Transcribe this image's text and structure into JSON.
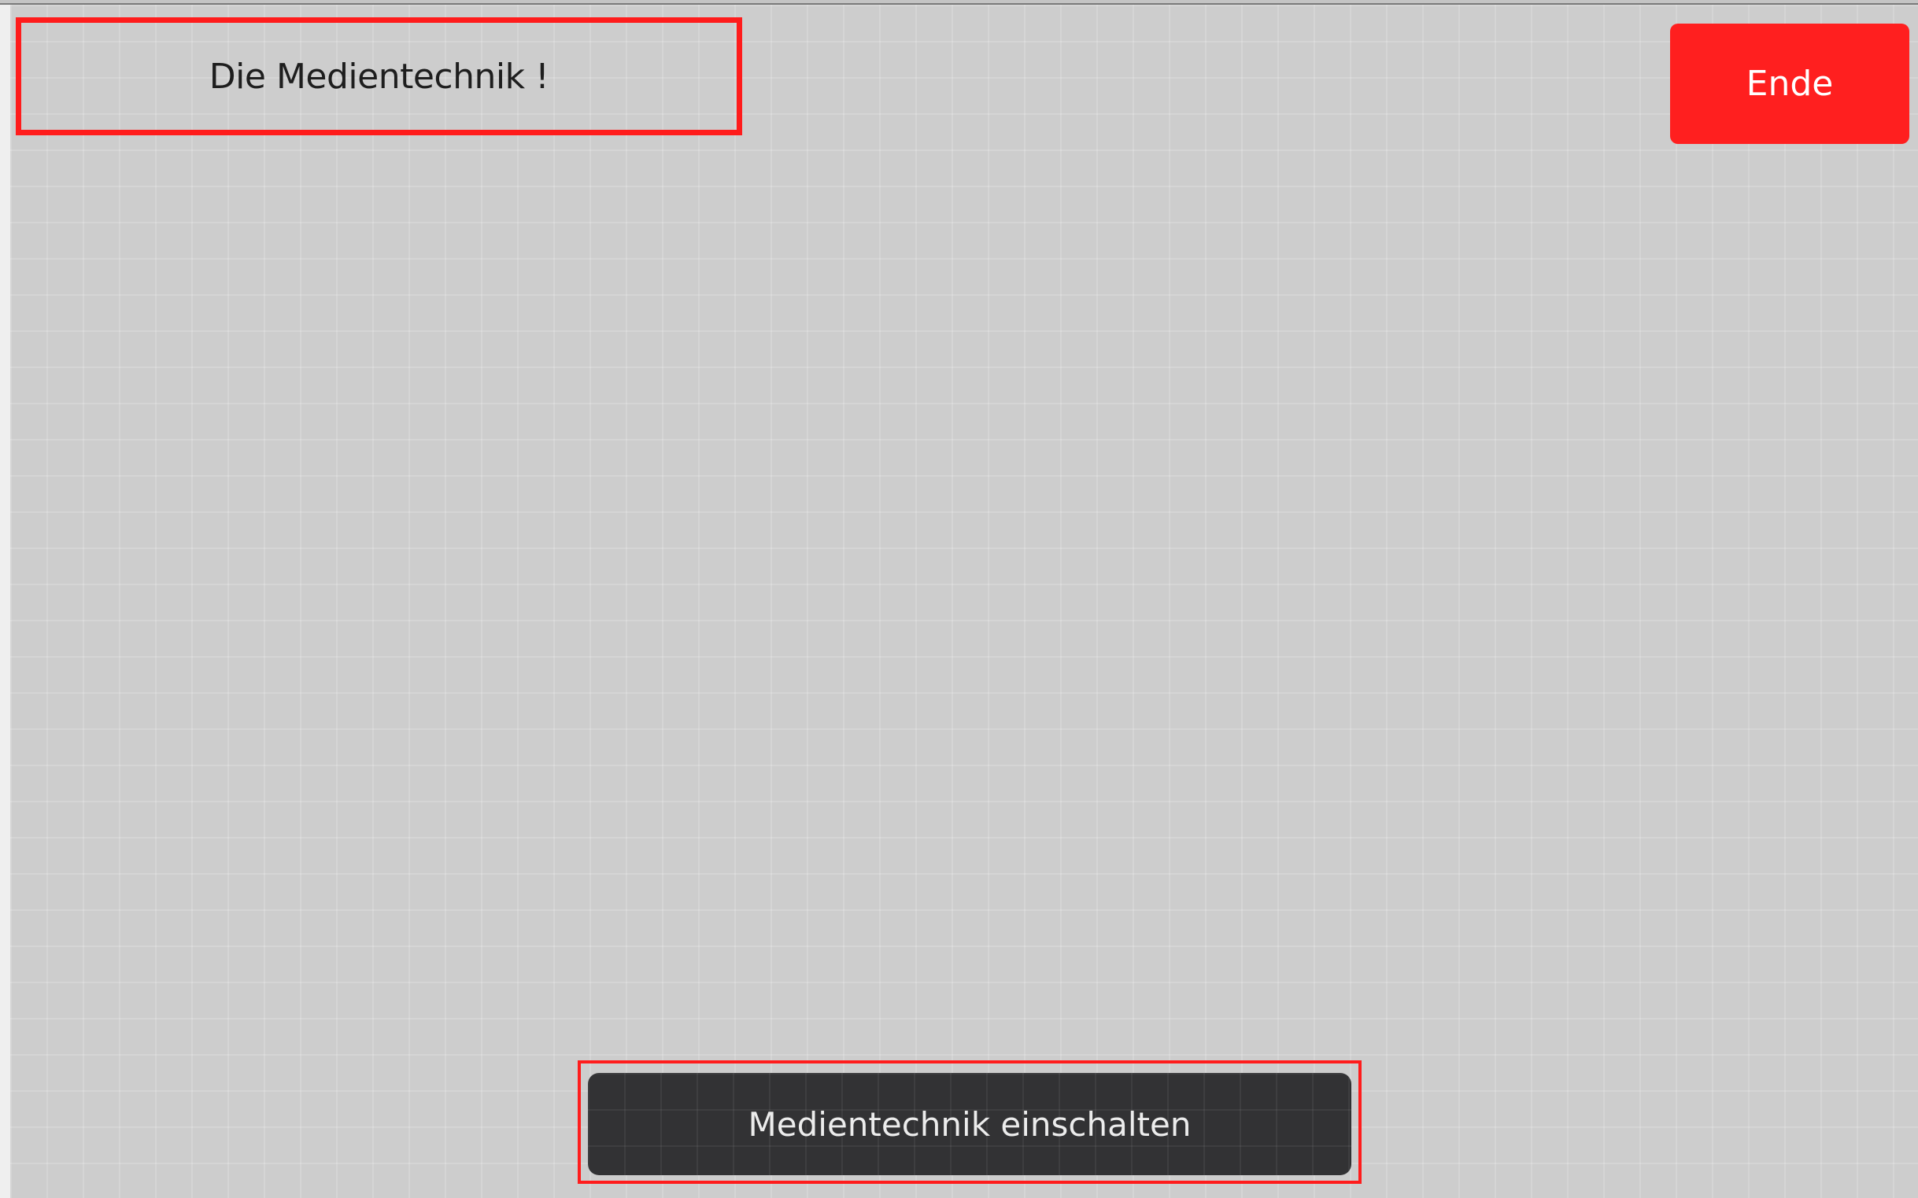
{
  "header": {
    "title": "Die Medientechnik !"
  },
  "actions": {
    "end_label": "Ende",
    "power_on_label": "Medientechnik einschalten"
  },
  "colors": {
    "panel_background": "#cdcdcd",
    "accent_red": "#ff1f1f",
    "button_dark": "#323234",
    "title_text": "#1e1e1e"
  }
}
